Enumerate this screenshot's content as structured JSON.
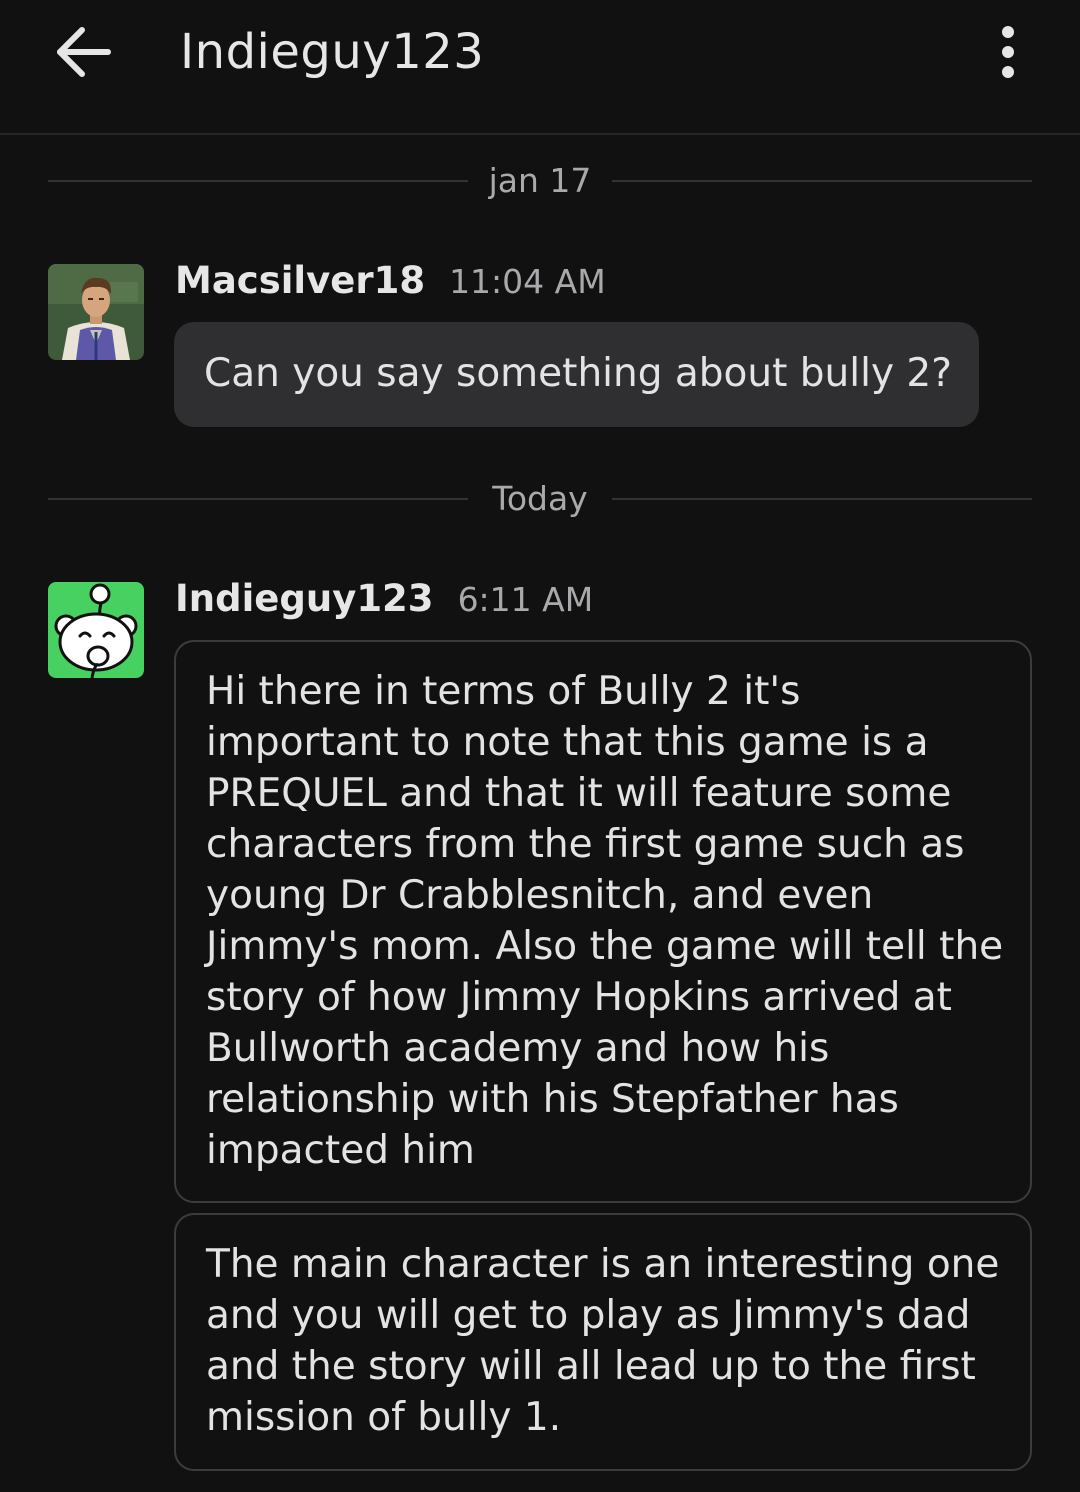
{
  "header": {
    "title": "Indieguy123",
    "back_icon": "arrow-left-icon",
    "more_icon": "more-vertical-icon"
  },
  "dividers": [
    {
      "label": "jan 17"
    },
    {
      "label": "Today"
    }
  ],
  "messages": [
    {
      "author": "Macsilver18",
      "time": "11:04 AM",
      "text": "Can you say something about bully 2?"
    },
    {
      "author": "Indieguy123",
      "time": "6:11 AM",
      "bubbles": [
        {
          "lines": [
            "Hi there in terms of Bully 2 it's",
            "important to note that this game is a",
            "PREQUEL and that it will feature some",
            "characters from the first game such as",
            "young Dr Crabblesnitch, and even",
            "Jimmy's mom. Also the game will tell the",
            "story of how Jimmy Hopkins arrived at",
            "Bullworth academy and how his",
            "relationship with his Stepfather has",
            "impacted him"
          ]
        },
        {
          "lines": [
            "The main character is an interesting one",
            "and you will get to play as Jimmy's dad",
            "and the story will all lead up to the first",
            "mission of bully 1."
          ]
        }
      ]
    }
  ],
  "colors": {
    "background": "#111112",
    "bubble_fill": "#2f2f31",
    "bubble_border": "#3c3c3f",
    "muted_text": "#a9a9ab",
    "snoo_green": "#46d160"
  }
}
